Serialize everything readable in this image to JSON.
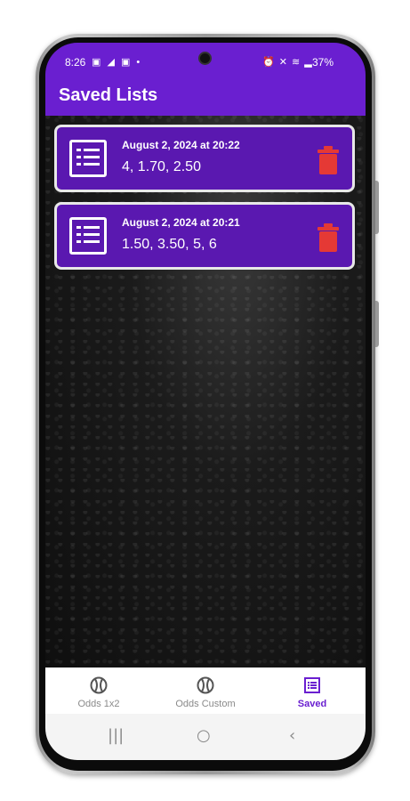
{
  "status_bar": {
    "time": "8:26",
    "left_icons": "▣ ◢ ▣ •",
    "right_icons": "⏰ ✕ ≋ ▂",
    "battery": "37%"
  },
  "app_bar": {
    "title": "Saved Lists"
  },
  "saved_lists": [
    {
      "date": "August 2, 2024 at 20:22",
      "values": "4, 1.70, 2.50"
    },
    {
      "date": "August 2, 2024 at 20:21",
      "values": "1.50, 3.50, 5, 6"
    }
  ],
  "bottom_nav": {
    "items": [
      {
        "label": "Odds 1x2",
        "icon": "soccer-ball-icon",
        "active": false
      },
      {
        "label": "Odds Custom",
        "icon": "soccer-ball-icon",
        "active": false
      },
      {
        "label": "Saved",
        "icon": "list-icon",
        "active": true
      }
    ]
  },
  "system_nav": {
    "recent": "|||",
    "home": "○",
    "back": "‹"
  },
  "colors": {
    "accent": "#6a1fd0",
    "card": "#5a18b0",
    "delete": "#e53935"
  }
}
